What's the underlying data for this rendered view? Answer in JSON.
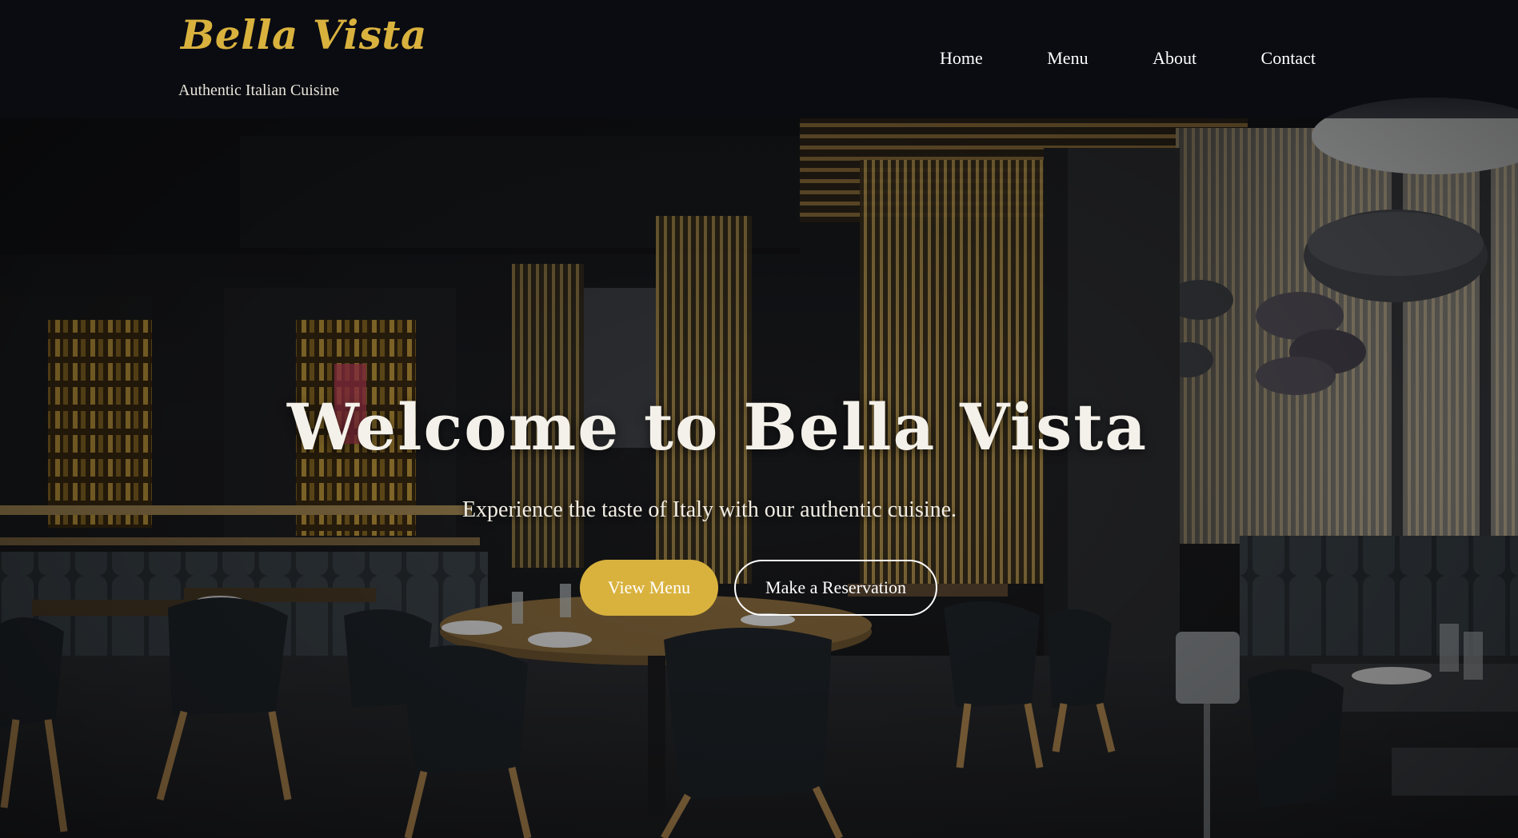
{
  "brand": {
    "name": "Bella Vista",
    "tagline": "Authentic Italian Cuisine"
  },
  "nav": {
    "items": [
      {
        "label": "Home"
      },
      {
        "label": "Menu"
      },
      {
        "label": "About"
      },
      {
        "label": "Contact"
      }
    ]
  },
  "hero": {
    "title": "Welcome to Bella Vista",
    "subtitle": "Experience the taste of Italy with our authentic cuisine.",
    "primary_cta": "View Menu",
    "secondary_cta": "Make a Reservation"
  },
  "theme": {
    "accent": "#d9b23e",
    "header_bg": "#0b0c12",
    "text_light": "#ffffff"
  }
}
